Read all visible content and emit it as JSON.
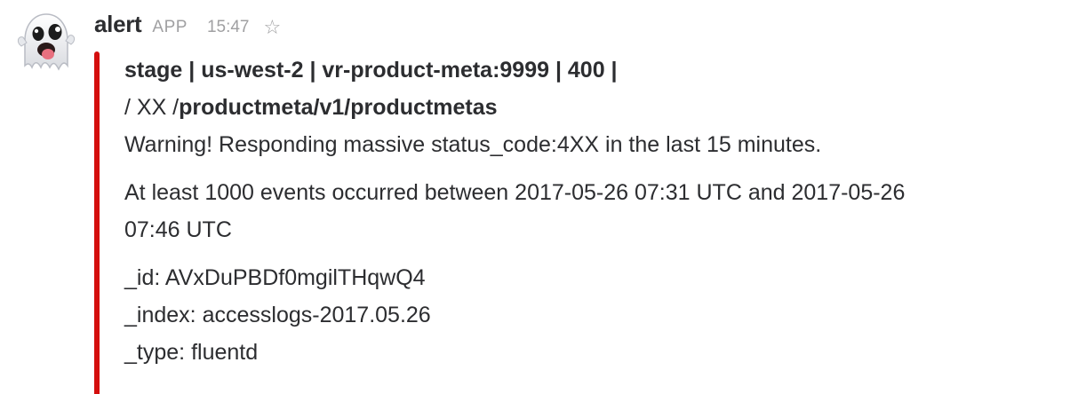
{
  "message": {
    "sender": "alert",
    "badge": "APP",
    "time": "15:47",
    "avatar_icon": "ghost-emoji",
    "star_icon": "star-outline-icon"
  },
  "attachment": {
    "bar_color": "#d40e0d",
    "title_line1": "stage | us-west-2 | vr-product-meta:9999 | 400 |",
    "title_line2_prefix": "/ XX /",
    "title_line2_path": "productmeta/v1/productmetas",
    "warning": "Warning! Responding massive status_code:4XX in the last 15 minutes.",
    "events_line1": "At least 1000 events occurred between 2017-05-26 07:31 UTC and 2017-05-26",
    "events_line2": "07:46 UTC",
    "fields": [
      {
        "key": "_id:",
        "value": "AVxDuPBDf0mgilTHqwQ4"
      },
      {
        "key": "_index:",
        "value": "accesslogs-2017.05.26"
      },
      {
        "key": "_type:",
        "value": "fluentd"
      }
    ]
  }
}
